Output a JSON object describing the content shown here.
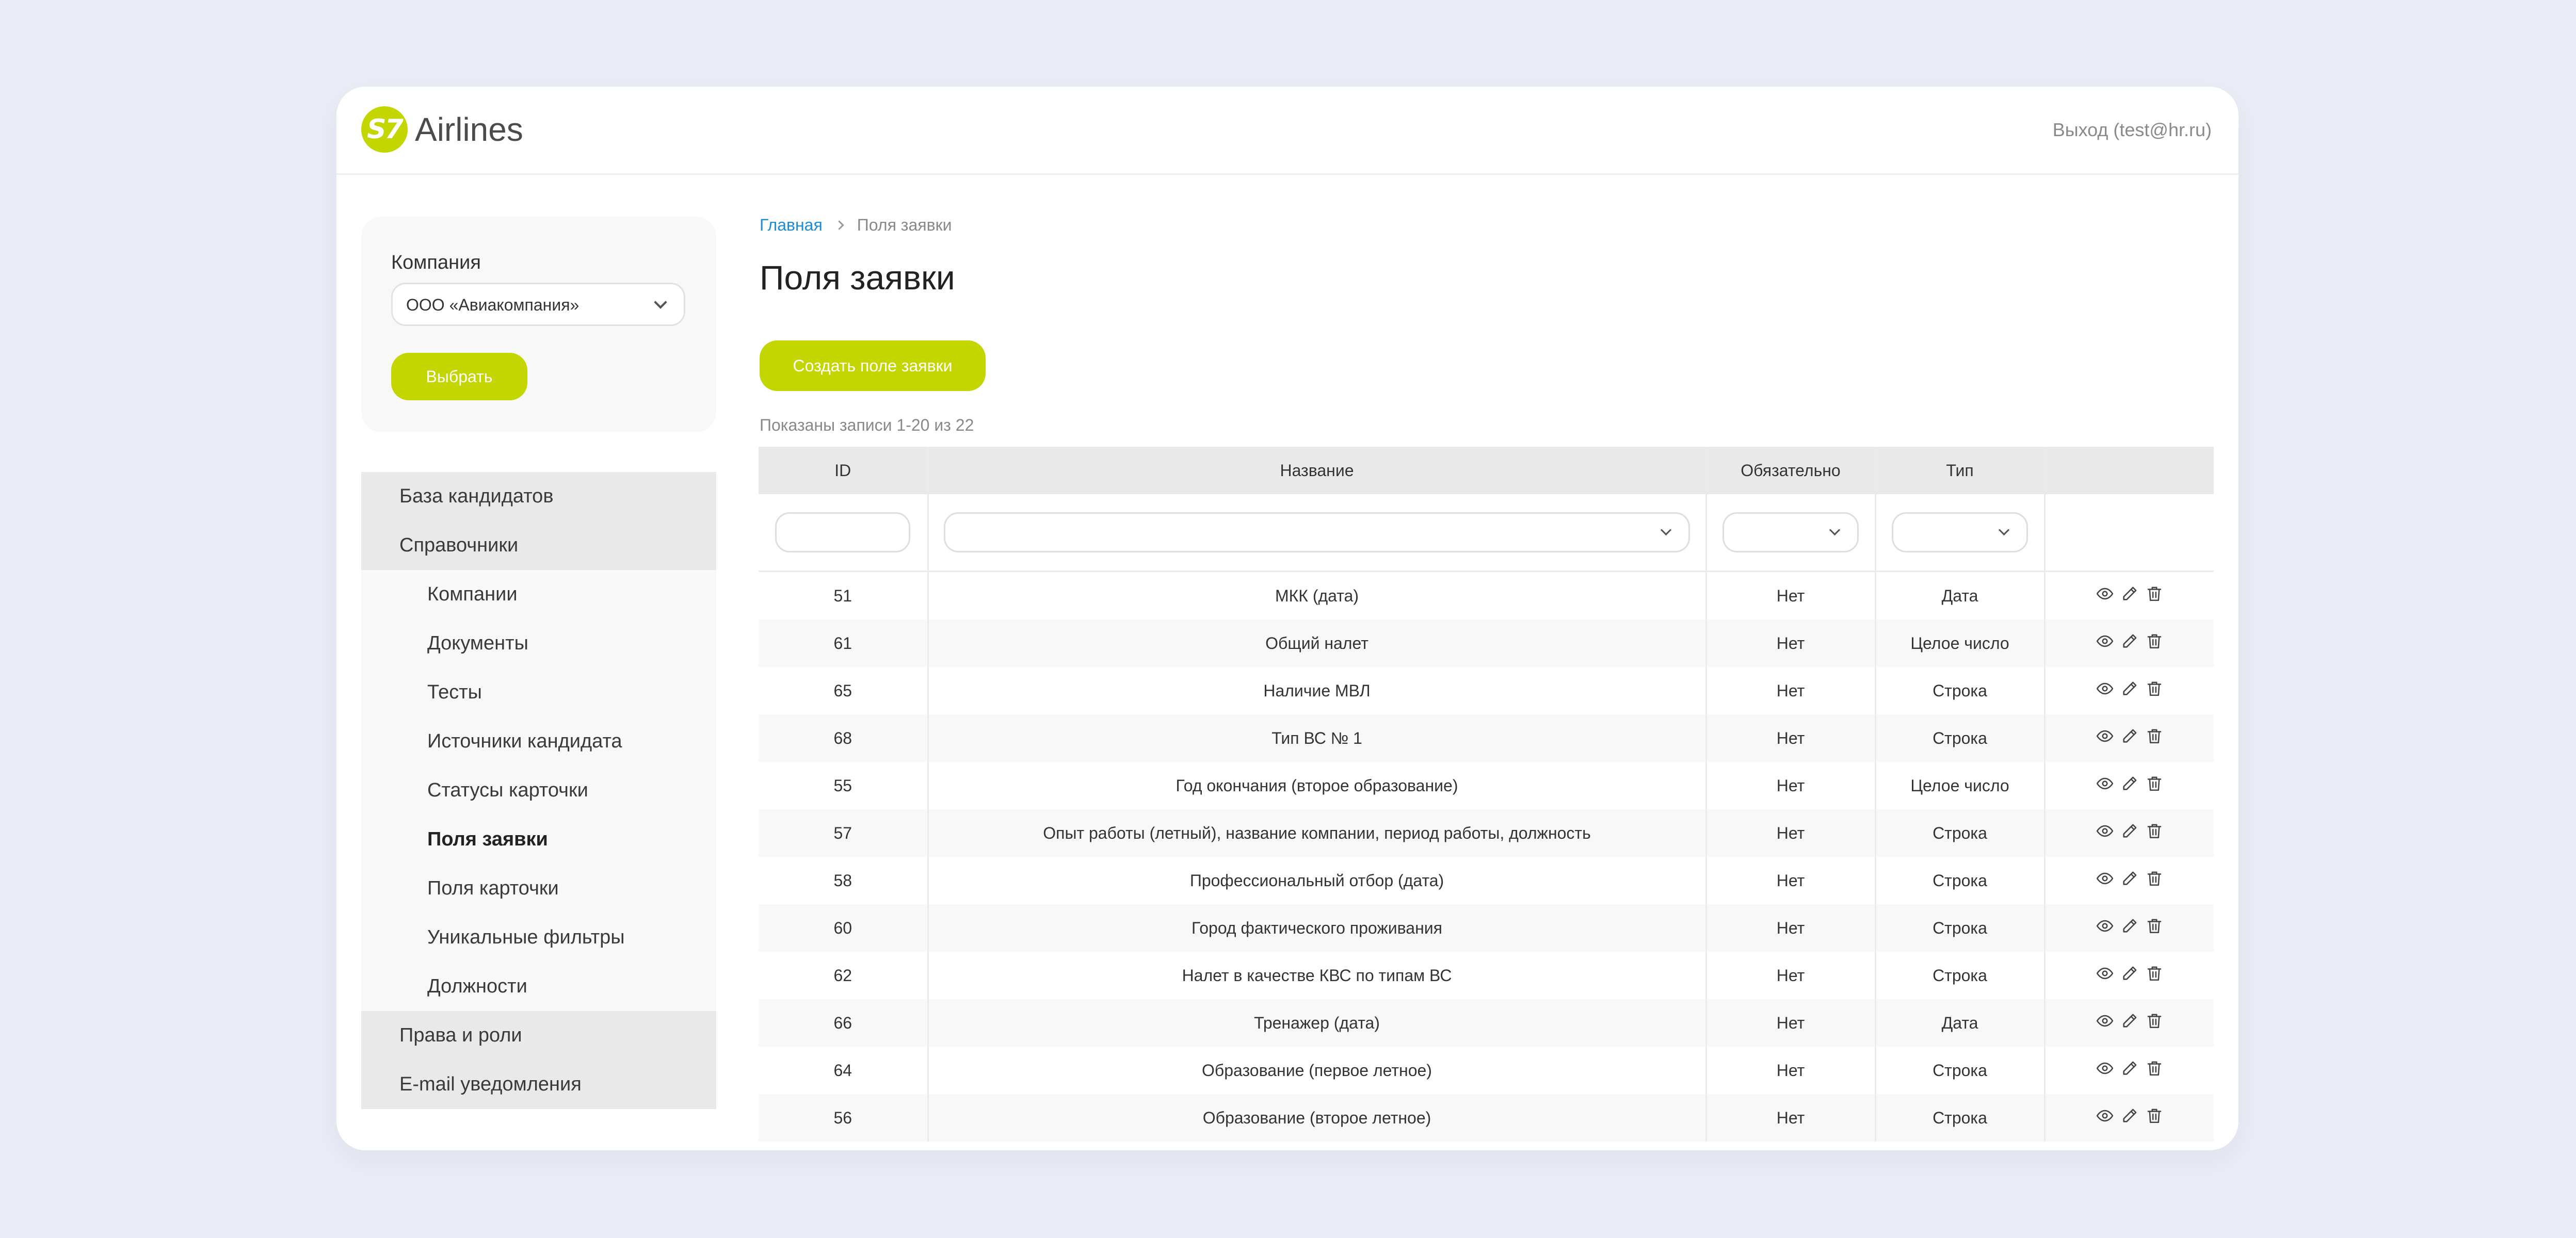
{
  "header": {
    "logo_badge": "S7",
    "logo_text": "Airlines",
    "logout": "Выход (test@hr.ru)"
  },
  "sidebar": {
    "company_label": "Компания",
    "company_value": "ООО «Авиакомпания»",
    "choose_button": "Выбрать",
    "nav": [
      {
        "label": "База кандидатов",
        "level": "top"
      },
      {
        "label": "Справочники",
        "level": "top"
      },
      {
        "label": "Компании",
        "level": "sub"
      },
      {
        "label": "Документы",
        "level": "sub"
      },
      {
        "label": "Тесты",
        "level": "sub"
      },
      {
        "label": "Источники кандидата",
        "level": "sub"
      },
      {
        "label": "Статусы карточки",
        "level": "sub"
      },
      {
        "label": "Поля заявки",
        "level": "sub",
        "active": true
      },
      {
        "label": "Поля карточки",
        "level": "sub"
      },
      {
        "label": "Уникальные фильтры",
        "level": "sub"
      },
      {
        "label": "Должности",
        "level": "sub"
      },
      {
        "label": "Права и роли",
        "level": "top"
      },
      {
        "label": "E-mail уведомления",
        "level": "top"
      }
    ]
  },
  "main": {
    "breadcrumb_home": "Главная",
    "breadcrumb_current": "Поля заявки",
    "title": "Поля заявки",
    "create_button": "Создать поле заявки",
    "records_info": "Показаны записи 1-20 из 22"
  },
  "table": {
    "columns": [
      "ID",
      "Название",
      "Обязательно",
      "Тип",
      ""
    ],
    "rows": [
      {
        "id": "51",
        "name": "МКК (дата)",
        "required": "Нет",
        "type": "Дата"
      },
      {
        "id": "61",
        "name": "Общий налет",
        "required": "Нет",
        "type": "Целое число"
      },
      {
        "id": "65",
        "name": "Наличие МВЛ",
        "required": "Нет",
        "type": "Строка"
      },
      {
        "id": "68",
        "name": "Тип ВС № 1",
        "required": "Нет",
        "type": "Строка"
      },
      {
        "id": "55",
        "name": "Год окончания  (второе образование)",
        "required": "Нет",
        "type": "Целое число"
      },
      {
        "id": "57",
        "name": "Опыт работы (летный), название  компании, период работы, должность",
        "required": "Нет",
        "type": "Строка"
      },
      {
        "id": "58",
        "name": "Профессиональный отбор (дата)",
        "required": "Нет",
        "type": "Строка"
      },
      {
        "id": "60",
        "name": "Город фактического проживания",
        "required": "Нет",
        "type": "Строка"
      },
      {
        "id": "62",
        "name": "Налет в качестве КВС по типам ВС",
        "required": "Нет",
        "type": "Строка"
      },
      {
        "id": "66",
        "name": "Тренажер (дата)",
        "required": "Нет",
        "type": "Дата"
      },
      {
        "id": "64",
        "name": "Образование (первое летное)",
        "required": "Нет",
        "type": "Строка"
      },
      {
        "id": "56",
        "name": "Образование (второе летное)",
        "required": "Нет",
        "type": "Строка"
      }
    ],
    "row_actions": [
      "eye-icon",
      "pencil-icon",
      "trash-icon"
    ]
  },
  "colors": {
    "accent": "#c4d600",
    "link": "#1a8cd8",
    "page_bg": "#eaedf5"
  }
}
